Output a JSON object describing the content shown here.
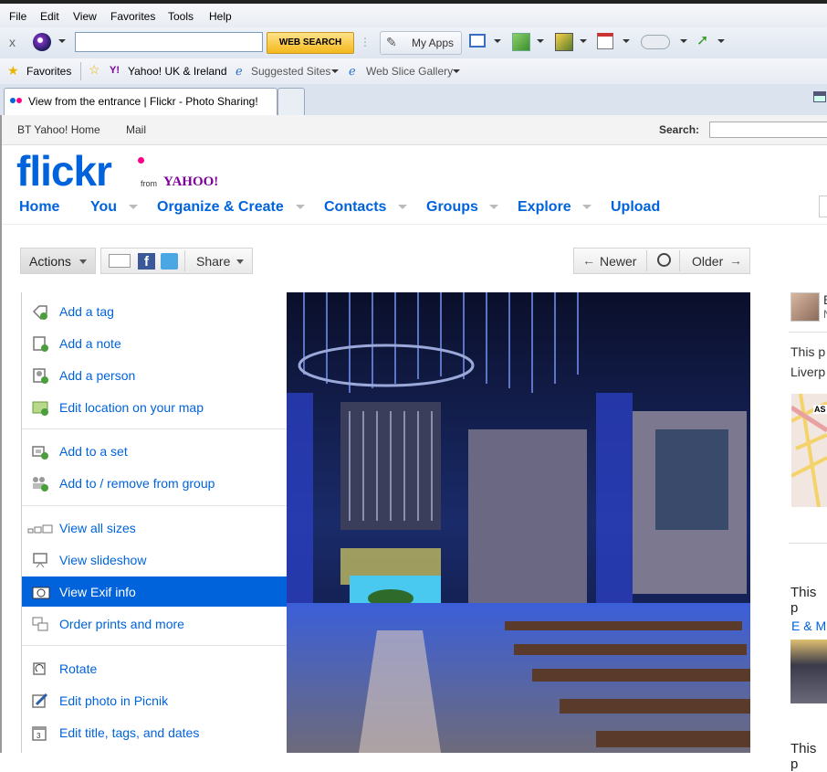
{
  "menubar": {
    "items": [
      "File",
      "Edit",
      "View",
      "Favorites",
      "Tools",
      "Help"
    ]
  },
  "toolbar": {
    "close": "x",
    "search_value": "",
    "search_button": "WEB SEARCH",
    "my_apps": "My Apps"
  },
  "favbar": {
    "favorites": "Favorites",
    "yahoo": "Yahoo! UK & Ireland",
    "yahoo_logo": "Y!",
    "suggested": "Suggested Sites",
    "webslice": "Web Slice Gallery"
  },
  "tab": {
    "title": "View from the entrance | Flickr - Photo Sharing!"
  },
  "ybar": {
    "home": "BT Yahoo! Home",
    "mail": "Mail",
    "search_label": "Search:"
  },
  "logo": {
    "flickr": "flickr",
    "from": "from",
    "yahoo": "YAHOO!"
  },
  "nav": [
    "Home",
    "You",
    "Organize & Create",
    "Contacts",
    "Groups",
    "Explore",
    "Upload"
  ],
  "actions": {
    "actions": "Actions",
    "share": "Share",
    "newer": "Newer",
    "older": "Older"
  },
  "menu": {
    "items": [
      {
        "label": "Add a tag"
      },
      {
        "label": "Add a note"
      },
      {
        "label": "Add a person"
      },
      {
        "label": "Edit location on your map"
      },
      {
        "label": "Add to a set"
      },
      {
        "label": "Add to / remove from group"
      },
      {
        "label": "View all sizes"
      },
      {
        "label": "View slideshow"
      },
      {
        "label": "View Exif info"
      },
      {
        "label": "Order prints and more"
      },
      {
        "label": "Rotate"
      },
      {
        "label": "Edit photo in Picnik"
      },
      {
        "label": "Edit title, tags, and dates"
      }
    ]
  },
  "side": {
    "text1": "This p",
    "text2": "Liverp",
    "text3": "This p",
    "text4": "E & M",
    "text5": "This p",
    "map_label": "AS",
    "avatar_letter": "E",
    "avatar_letter2": "N"
  }
}
